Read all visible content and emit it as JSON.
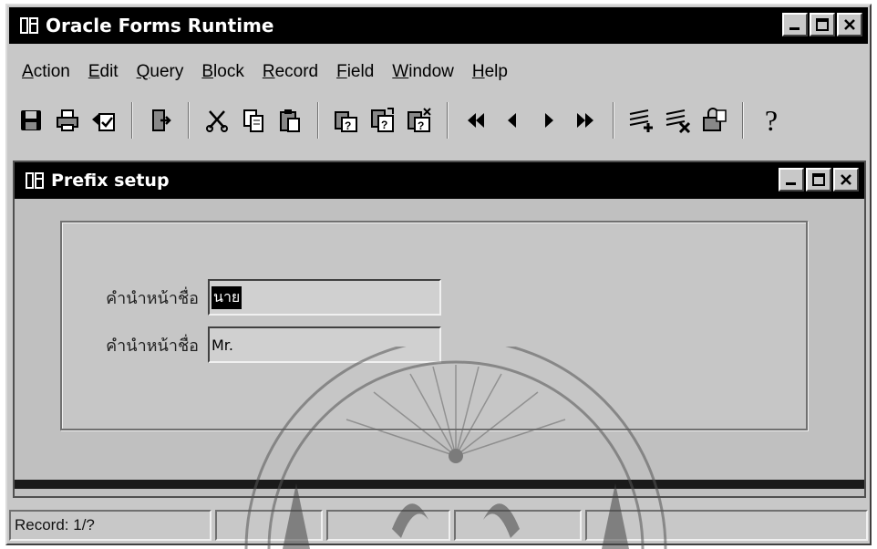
{
  "app": {
    "title": "Oracle Forms Runtime"
  },
  "menu": [
    {
      "accel": "A",
      "rest": "ction"
    },
    {
      "accel": "E",
      "rest": "dit"
    },
    {
      "accel": "Q",
      "rest": "uery"
    },
    {
      "accel": "B",
      "rest": "lock"
    },
    {
      "accel": "R",
      "rest": "ecord"
    },
    {
      "accel": "F",
      "rest": "ield"
    },
    {
      "accel": "W",
      "rest": "indow"
    },
    {
      "accel": "H",
      "rest": "elp"
    }
  ],
  "toolbar": {
    "icons": [
      "save-icon",
      "print-icon",
      "commit-icon",
      "exit-icon",
      "cut-icon",
      "copy-icon",
      "paste-icon",
      "enter-query-icon",
      "execute-query-icon",
      "cancel-query-icon",
      "previous-block-icon",
      "previous-record-icon",
      "next-record-icon",
      "next-block-icon",
      "insert-record-icon",
      "delete-record-icon",
      "lock-record-icon",
      "help-icon"
    ],
    "help_label": "?"
  },
  "form": {
    "title": "Prefix setup",
    "fields": [
      {
        "label": "คำนำหน้าชื่อ",
        "value": "นาย"
      },
      {
        "label": "คำนำหน้าชื่อ",
        "value": "Mr."
      }
    ]
  },
  "status": {
    "record": "Record: 1/?"
  },
  "colors": {
    "titlebar": "#000000",
    "window_bg": "#c8c8c8",
    "selection": "#000000"
  }
}
